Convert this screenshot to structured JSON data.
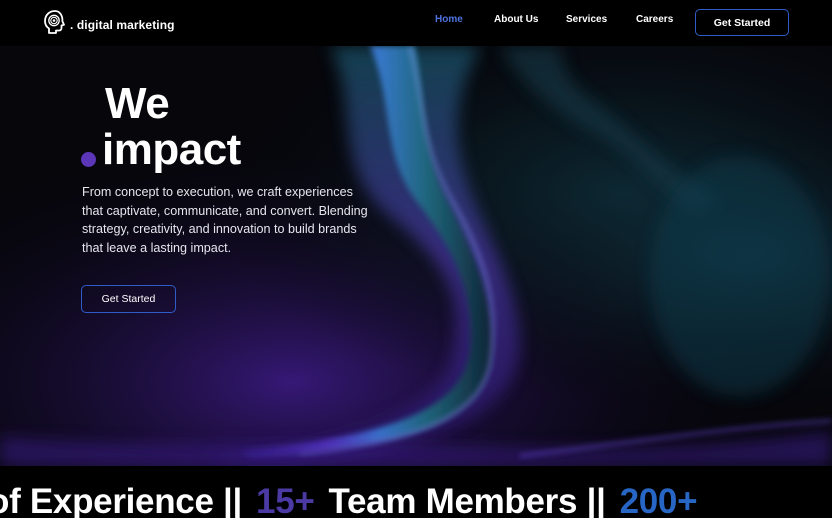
{
  "brand": {
    "name": ". digital marketing",
    "logo_icon": "fingerprint-head-icon"
  },
  "nav": {
    "links": [
      {
        "label": "Home",
        "active": true
      },
      {
        "label": "About Us",
        "active": false
      },
      {
        "label": "Services",
        "active": false
      },
      {
        "label": "Careers",
        "active": false
      }
    ],
    "cta_label": "Get Started"
  },
  "hero": {
    "headline_line1": "We",
    "headline_line2": "impact",
    "description": "From concept to execution, we craft experiences that captivate, communicate, and convert. Blending strategy, creativity, and innovation to build brands that leave a lasting impact.",
    "cta_label": "Get Started"
  },
  "stats": {
    "segment1": "of Experience ||",
    "number1": "15+",
    "segment2": "Team Members ||",
    "number2": "200+"
  },
  "colors": {
    "accent_blue": "#4e73df",
    "button_border": "#2f5cc9",
    "accent_purple": "#5b36b8",
    "stat_purple": "#4b3aa3",
    "stat_blue": "#2766c4"
  }
}
